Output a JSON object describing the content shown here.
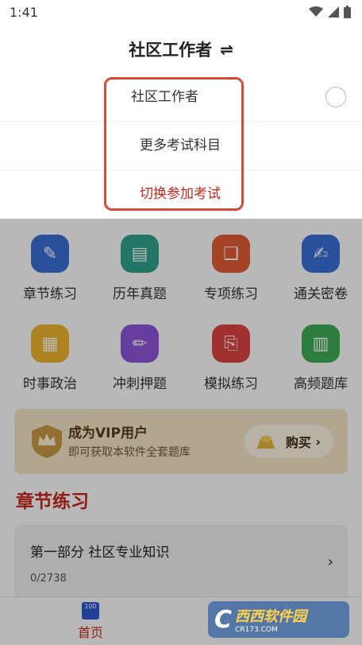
{
  "status": {
    "time": "1:41"
  },
  "header": {
    "title": "社区工作者",
    "swap_icon": "⇌"
  },
  "dropdown": {
    "items": [
      "社区工作者",
      "更多考试科目",
      "切换参加考试"
    ]
  },
  "grid": [
    {
      "label": "章节练习",
      "icon": "pen-icon",
      "color": "#3b6fd8"
    },
    {
      "label": "历年真题",
      "icon": "paper-icon",
      "color": "#2fa48e"
    },
    {
      "label": "专项练习",
      "icon": "book-icon",
      "color": "#e35d35"
    },
    {
      "label": "通关密卷",
      "icon": "edit-icon",
      "color": "#3b6fd8"
    },
    {
      "label": "时事政治",
      "icon": "newspaper-icon",
      "color": "#f0b42d"
    },
    {
      "label": "冲刺押题",
      "icon": "pencil-icon",
      "color": "#8e55d9"
    },
    {
      "label": "模拟练习",
      "icon": "clipboard-icon",
      "color": "#e04545"
    },
    {
      "label": "高频题库",
      "icon": "notebook-icon",
      "color": "#3fae57"
    }
  ],
  "vip": {
    "title": "成为VIP用户",
    "subtitle": "即可获取本软件全套题库",
    "buy_label": "购买"
  },
  "section": {
    "title": "章节练习"
  },
  "chapter": {
    "name": "第一部分  社区专业知识",
    "progress": "0/2738"
  },
  "nav": {
    "home_icon_text": "100",
    "home_label": "首页"
  },
  "watermark": {
    "c": "C",
    "main": "西西软件园",
    "url": "CR173.COM"
  }
}
